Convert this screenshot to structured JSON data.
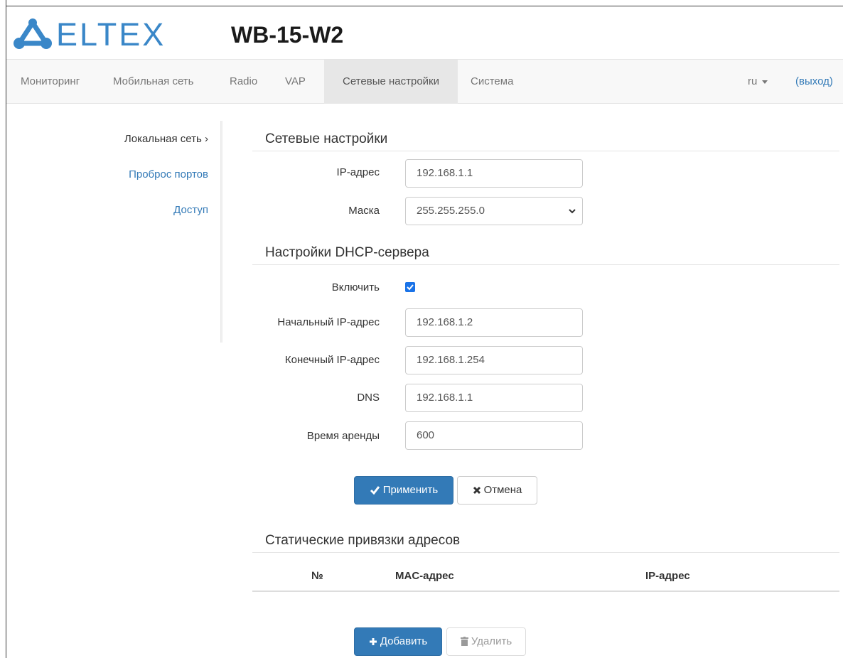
{
  "header": {
    "logo_text": "ELTEX",
    "model": "WB-15-W2"
  },
  "nav": {
    "items": [
      {
        "label": "Мониторинг",
        "active": false
      },
      {
        "label": "Мобильная сеть",
        "active": false
      },
      {
        "label": "Radio",
        "active": false
      },
      {
        "label": "VAP",
        "active": false
      },
      {
        "label": "Сетевые настройки",
        "active": true
      },
      {
        "label": "Система",
        "active": false
      }
    ],
    "language": "ru",
    "logout": "(выход)"
  },
  "sidebar": {
    "items": [
      {
        "label": "Локальная сеть ›",
        "active": true
      },
      {
        "label": "Проброс портов",
        "active": false
      },
      {
        "label": "Доступ",
        "active": false
      }
    ]
  },
  "network": {
    "title": "Сетевые настройки",
    "ip_label": "IP-адрес",
    "ip_value": "192.168.1.1",
    "mask_label": "Маска",
    "mask_value": "255.255.255.0"
  },
  "dhcp": {
    "title": "Настройки DHCP-сервера",
    "enable_label": "Включить",
    "enabled": true,
    "start_label": "Начальный IP-адрес",
    "start_value": "192.168.1.2",
    "end_label": "Конечный IP-адрес",
    "end_value": "192.168.1.254",
    "dns_label": "DNS",
    "dns_value": "192.168.1.1",
    "lease_label": "Время аренды",
    "lease_value": "600"
  },
  "actions": {
    "apply": "Применить",
    "cancel": "Отмена"
  },
  "static": {
    "title": "Статические привязки адресов",
    "columns": [
      "№",
      "MAC-адрес",
      "IP-адрес"
    ],
    "add": "Добавить",
    "delete": "Удалить"
  },
  "colors": {
    "brand": "#3a87c8",
    "primary": "#337ab7",
    "link": "#337ab7"
  }
}
